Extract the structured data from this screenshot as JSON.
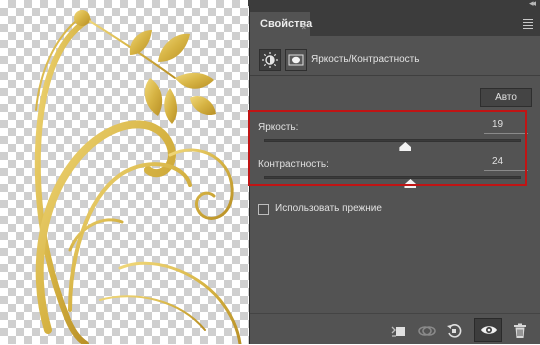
{
  "panel": {
    "collapse_glyph": "◂◂",
    "tab_label": "Свойства",
    "close_glyph": "×",
    "title": "Яркость/Контрастность",
    "auto_button": "Авто",
    "brightness": {
      "label": "Яркость:",
      "value": "19",
      "level": 0.55
    },
    "contrast": {
      "label": "Контрастность:",
      "value": "24",
      "level": 0.57
    },
    "use_legacy": {
      "label": "Использовать прежние",
      "checked": false
    }
  },
  "icons": {
    "adjustment": "sun-icon",
    "mask": "mask-icon",
    "clip": "clip-to-layer-icon",
    "view_previous": "view-previous-state-icon",
    "reset": "reset-icon",
    "visibility": "eye-icon",
    "delete": "trash-icon"
  },
  "colors": {
    "panel_bg": "#535353",
    "highlight": "#c01414",
    "ornament_gold": "#d9b94a"
  }
}
